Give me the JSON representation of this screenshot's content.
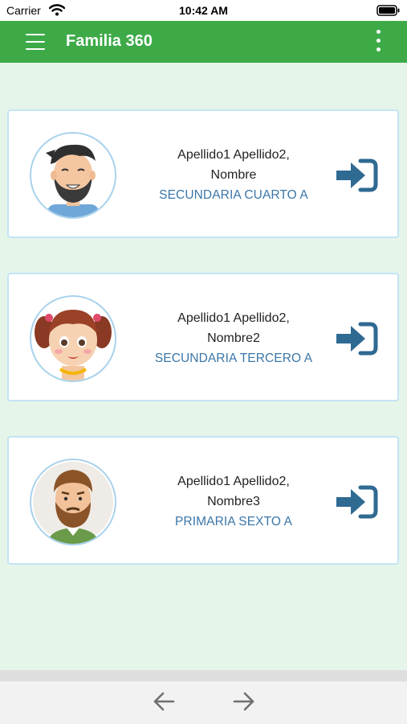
{
  "status": {
    "carrier": "Carrier",
    "time": "10:42 AM"
  },
  "app": {
    "title": "Familia 360",
    "accent": "#3daa47"
  },
  "students": [
    {
      "name": "Apellido1 Apellido2, Nombre",
      "grade": "SECUNDARIA CUARTO A",
      "avatar": "man-avatar"
    },
    {
      "name": "Apellido1 Apellido2, Nombre2",
      "grade": "SECUNDARIA TERCERO A",
      "avatar": "girl-avatar"
    },
    {
      "name": "Apellido1 Apellido2, Nombre3",
      "grade": "PRIMARIA SEXTO A",
      "avatar": "bearded-man-avatar"
    }
  ],
  "icons": {
    "menu": "hamburger-menu-icon",
    "more": "more-vertical-icon",
    "login": "login-arrow-icon",
    "back": "arrow-left-icon",
    "forward": "arrow-right-icon"
  },
  "colors": {
    "grade_text": "#3a76a8",
    "login_icon": "#2f6a92",
    "background": "#e6f5ea"
  }
}
